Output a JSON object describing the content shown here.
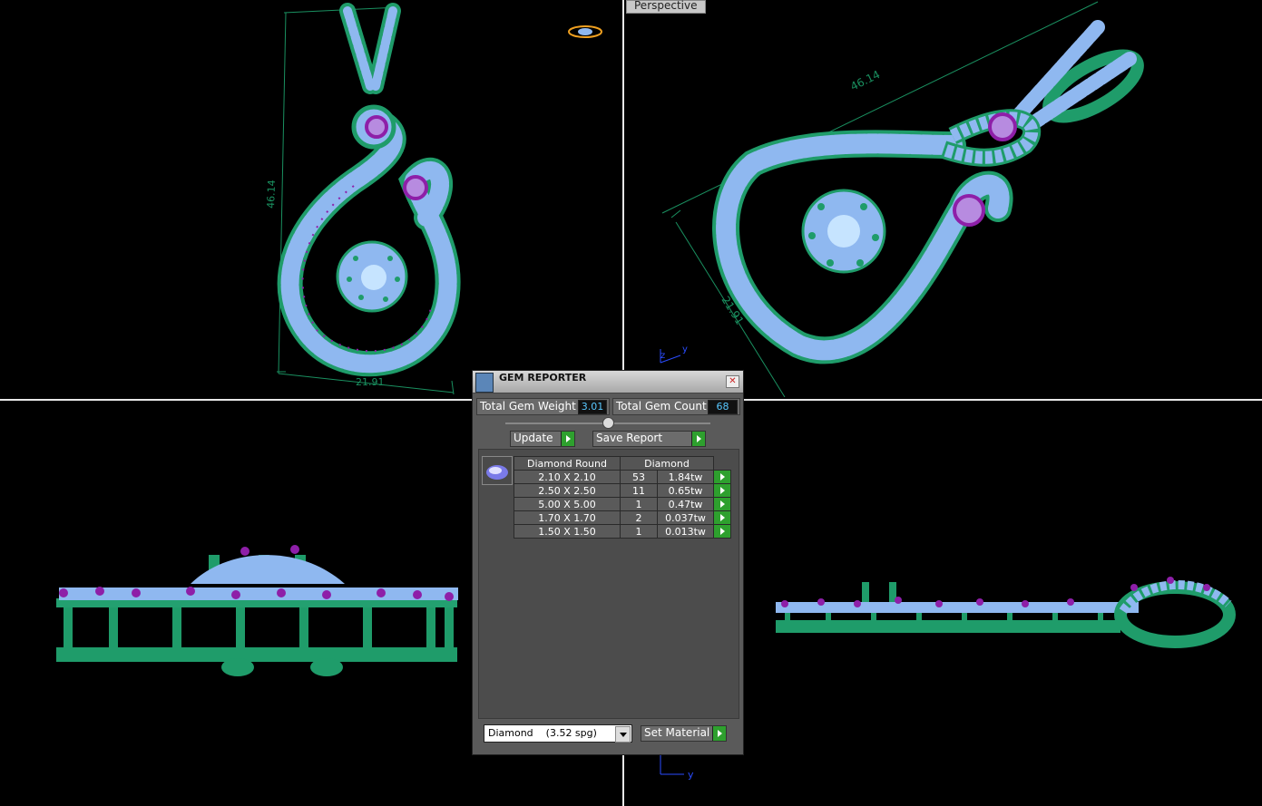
{
  "viewports": {
    "top_right_label": "Perspective",
    "front_dims": {
      "height": "46.14",
      "width": "21.91"
    },
    "persp_dims": {
      "height": "46.14",
      "width": "21.91"
    },
    "axis_labels": {
      "z": "z",
      "y": "y"
    }
  },
  "gem_reporter": {
    "title": "GEM REPORTER",
    "close": "✕",
    "total_weight_label": "Total Gem Weight",
    "total_weight_value": "3.01",
    "total_count_label": "Total Gem Count",
    "total_count_value": "68",
    "update_label": "Update",
    "save_report_label": "Save Report",
    "table": {
      "headers": [
        "Diamond Round",
        "Diamond"
      ],
      "rows": [
        {
          "size": "2.10 X 2.10",
          "count": "53",
          "weight": "1.84tw"
        },
        {
          "size": "2.50 X 2.50",
          "count": "11",
          "weight": "0.65tw"
        },
        {
          "size": "5.00 X 5.00",
          "count": "1",
          "weight": "0.47tw"
        },
        {
          "size": "1.70 X 1.70",
          "count": "2",
          "weight": "0.037tw"
        },
        {
          "size": "1.50 X 1.50",
          "count": "1",
          "weight": "0.013tw"
        }
      ]
    },
    "material_select": "Diamond    (3.52 spg)",
    "set_material_label": "Set Material"
  },
  "colors": {
    "metal": "#1f9c6a",
    "stone": "#8fb8f0",
    "prong": "#8e1fa8",
    "dim": "#1a9060"
  }
}
